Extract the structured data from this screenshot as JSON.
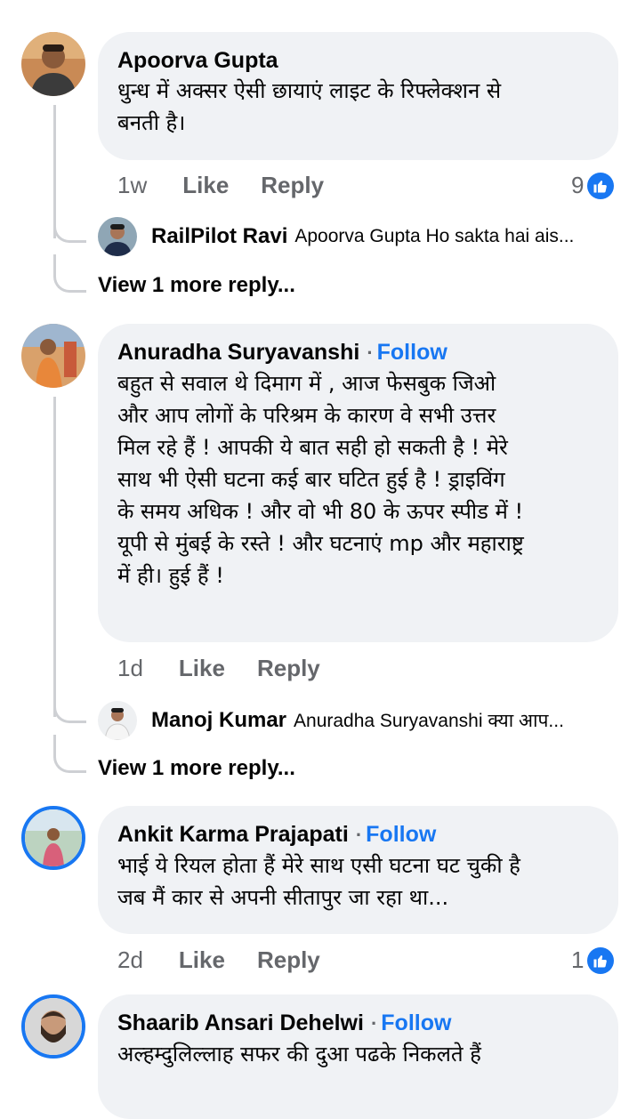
{
  "comments": [
    {
      "author": "Apoorva Gupta",
      "text_lines": [
        "धुन्ध में अक्सर ऐसी छायाएं लाइट के रिफ्लेक्शन से",
        "बनती है।"
      ],
      "time": "1w",
      "like": "Like",
      "reply": "Reply",
      "reactions": "9",
      "reply_preview": {
        "author": "RailPilot Ravi",
        "text": "Apoorva Gupta Ho sakta hai ais..."
      },
      "more_replies": "View 1 more reply..."
    },
    {
      "author": "Anuradha Suryavanshi",
      "separator": "·",
      "follow": "Follow",
      "text_lines": [
        "बहुत से सवाल थे दिमाग में , आज फेसबुक जिओ",
        "और आप लोगों के परिश्रम के कारण वे सभी उत्तर",
        "मिल रहे हैं ! आपकी ये बात सही हो सकती है ! मेरे",
        "साथ भी ऐसी घटना कई बार घटित हुई है ! ड्राइविंग",
        "के समय अधिक ! और वो भी 80 के ऊपर स्पीड में !",
        "यूपी से मुंबई के रस्ते ! और घटनाएं mp और महाराष्ट्र",
        "में ही। हुई हैं !"
      ],
      "time": "1d",
      "like": "Like",
      "reply": "Reply",
      "reply_preview": {
        "author": "Manoj Kumar",
        "text": "Anuradha Suryavanshi क्या आप..."
      },
      "more_replies": "View 1 more reply..."
    },
    {
      "author": "Ankit Karma Prajapati",
      "separator": "·",
      "follow": "Follow",
      "text_lines": [
        "भाई ये रियल होता हैं मेरे साथ एसी घटना घट चुकी है",
        "जब मैं कार से अपनी सीतापुर जा रहा था..."
      ],
      "time": "2d",
      "like": "Like",
      "reply": "Reply",
      "reactions": "1"
    },
    {
      "author": "Shaarib Ansari Dehelwi",
      "separator": "·",
      "follow": "Follow",
      "text_lines": [
        "अल्हम्दुलिल्लाह सफर की दुआ पढके निकलते हैं"
      ]
    }
  ],
  "icons": {
    "like_badge": "thumbs-up-icon"
  },
  "colors": {
    "accent": "#1877f2",
    "bubble": "#f0f2f5",
    "muted": "#65676b",
    "thread": "#ced0d4"
  }
}
